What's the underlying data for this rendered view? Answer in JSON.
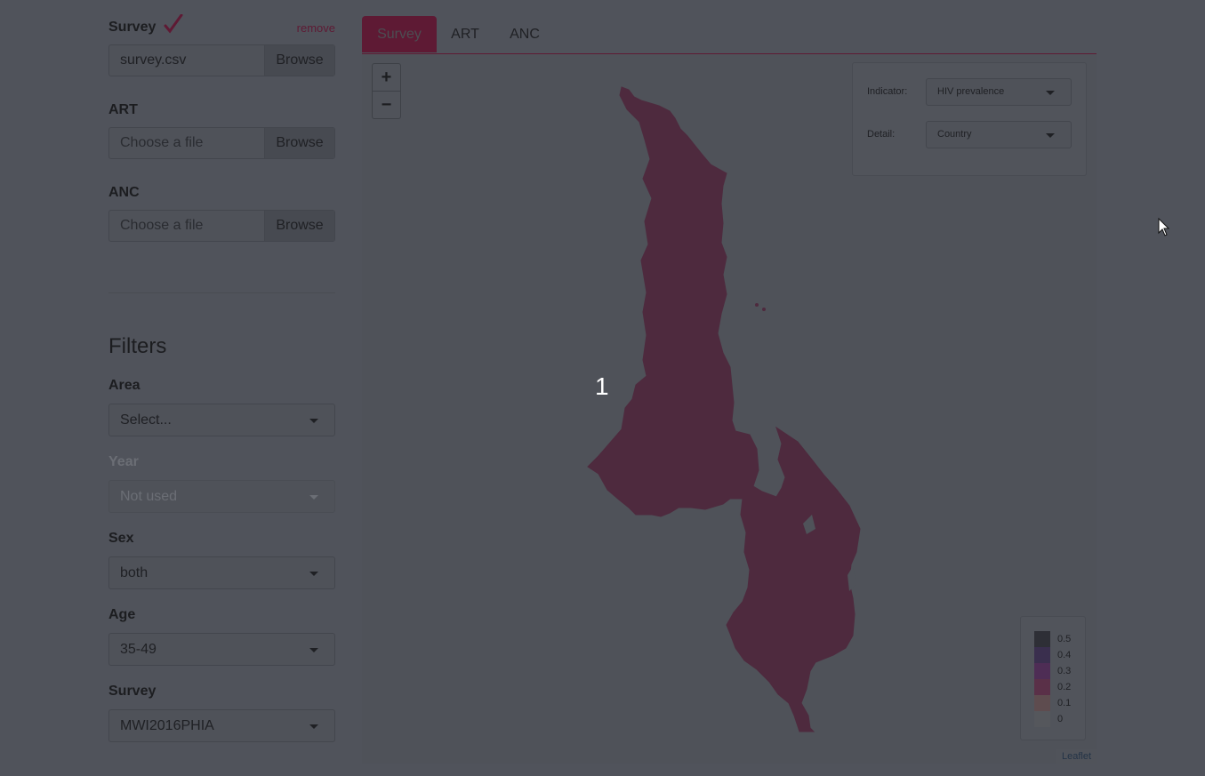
{
  "uploads": {
    "survey": {
      "label": "Survey",
      "file": "survey.csv",
      "remove": "remove",
      "browse": "Browse"
    },
    "art": {
      "label": "ART",
      "placeholder": "Choose a file",
      "browse": "Browse"
    },
    "anc": {
      "label": "ANC",
      "placeholder": "Choose a file",
      "browse": "Browse"
    }
  },
  "filters": {
    "title": "Filters",
    "area": {
      "label": "Area",
      "value": "Select..."
    },
    "year": {
      "label": "Year",
      "value": "Not used"
    },
    "sex": {
      "label": "Sex",
      "value": "both"
    },
    "age": {
      "label": "Age",
      "value": "35-49"
    },
    "survey": {
      "label": "Survey",
      "value": "MWI2016PHIA"
    }
  },
  "tabs": [
    {
      "label": "Survey",
      "active": true
    },
    {
      "label": "ART",
      "active": false
    },
    {
      "label": "ANC",
      "active": false
    }
  ],
  "map": {
    "zoom_in": "+",
    "zoom_out": "−",
    "region_label": "1",
    "region_color": "#4e2a3e",
    "indicator": {
      "label": "Indicator:",
      "value": "HIV prevalence"
    },
    "detail": {
      "label": "Detail:",
      "value": "Country"
    },
    "legend": [
      {
        "value": "0.5",
        "color": "#2e2f36"
      },
      {
        "value": "0.4",
        "color": "#3a2f4e"
      },
      {
        "value": "0.3",
        "color": "#4e2d55"
      },
      {
        "value": "0.2",
        "color": "#5a3048"
      },
      {
        "value": "0.1",
        "color": "#5e4c4f"
      },
      {
        "value": "0",
        "color": "#55575c"
      }
    ],
    "attribution": "Leaflet"
  },
  "colors": {
    "accent": "#5e1a34",
    "background": "#50535b"
  }
}
